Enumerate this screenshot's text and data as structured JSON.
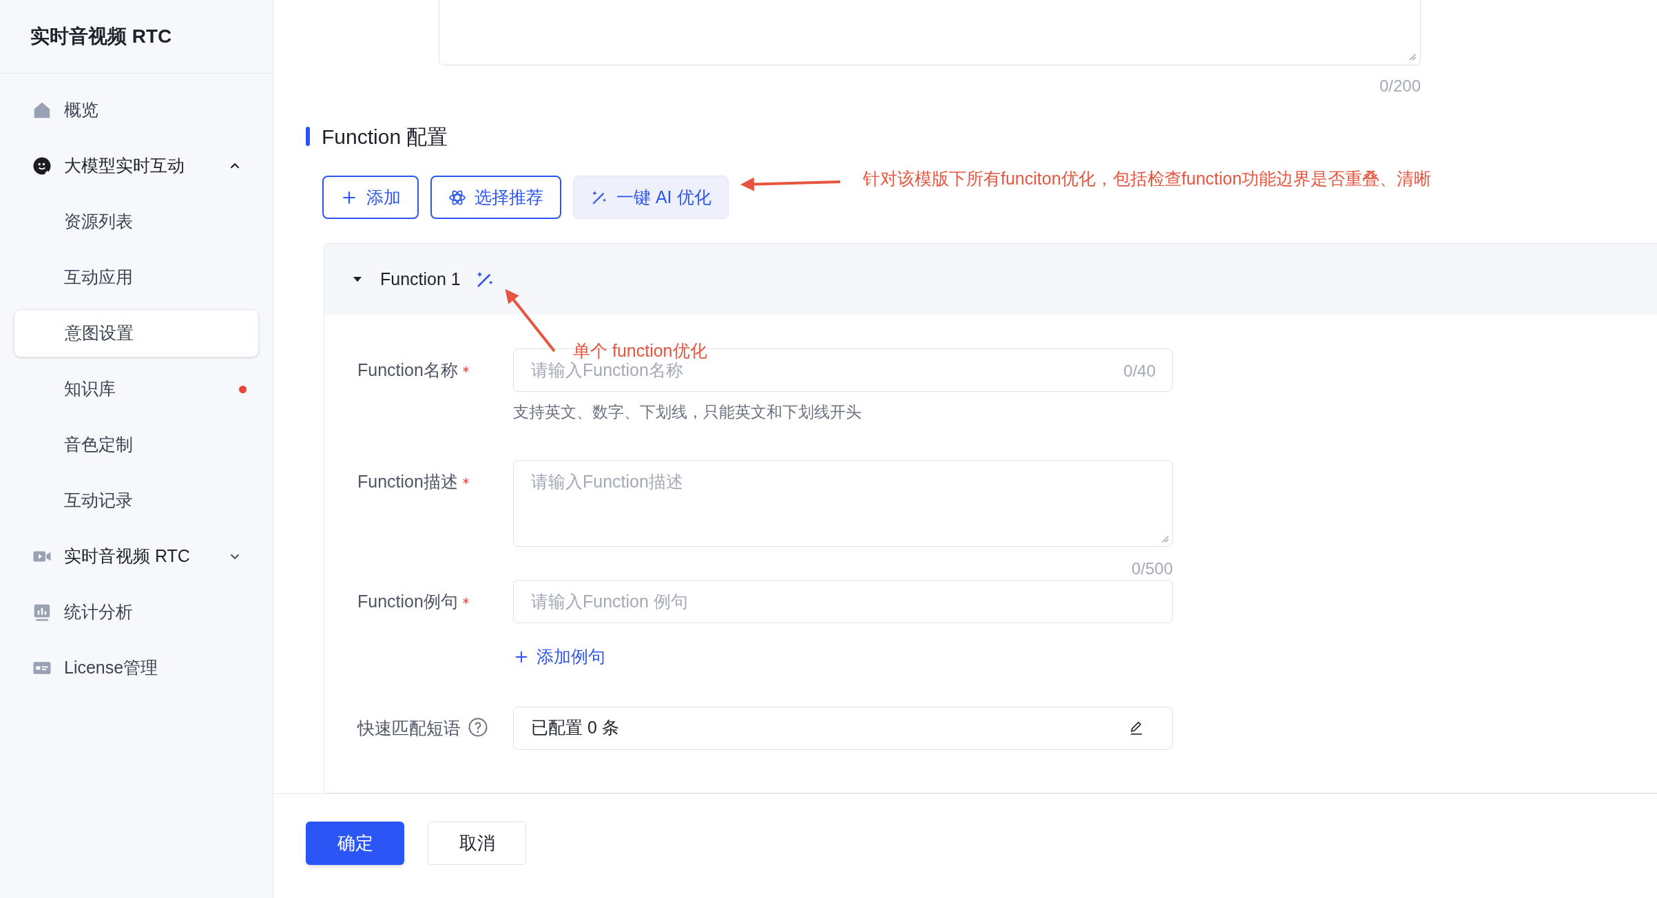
{
  "sidebar": {
    "title": "实时音视频 RTC",
    "items": [
      {
        "kind": "link",
        "label": "概览",
        "selected": false
      },
      {
        "kind": "group",
        "label": "大模型实时互动",
        "expanded": true,
        "children": [
          {
            "label": "资源列表",
            "selected": false
          },
          {
            "label": "互动应用",
            "selected": false
          },
          {
            "label": "意图设置",
            "selected": true
          },
          {
            "label": "知识库",
            "selected": false,
            "color": "#e5483b"
          },
          {
            "label": "音色定制",
            "selected": false
          },
          {
            "label": "互动记录",
            "selected": false
          }
        ]
      },
      {
        "kind": "group",
        "label": "实时音视频 RTC",
        "expanded": false
      },
      {
        "kind": "link",
        "label": "统计分析",
        "selected": false
      },
      {
        "kind": "link",
        "label": "License管理",
        "selected": false
      }
    ]
  },
  "main": {
    "top_counter": "0/200",
    "section_title": "Function 配置",
    "toolbar": [
      {
        "kind": "add",
        "label": "添加"
      },
      {
        "kind": "recommend",
        "label": "选择推荐"
      },
      {
        "kind": "ai",
        "label": "一键 AI 优化"
      }
    ],
    "function_card": {
      "title": "Function 1",
      "expanded": true,
      "fields": [
        {
          "kind": "input",
          "label": "Function名称",
          "required": true,
          "placeholder": "请输入Function名称",
          "counter": "0/40",
          "hint": "支持英文、数字、下划线，只能英文和下划线开头"
        },
        {
          "kind": "textarea",
          "label": "Function描述",
          "required": true,
          "placeholder": "请输入Function描述",
          "counter": "0/500"
        },
        {
          "kind": "input",
          "label": "Function例句",
          "required": true,
          "placeholder": "请输入Function 例句",
          "add_link": "添加例句"
        },
        {
          "kind": "readonly",
          "label": "快速匹配短语",
          "help": true,
          "value": "已配置 0 条"
        }
      ]
    }
  },
  "annotations": [
    {
      "text": "针对该模版下所有funciton优化，包括检查function功能边界是否重叠、清晰"
    },
    {
      "text": "单个 function优化"
    }
  ],
  "footer": {
    "buttons": [
      {
        "kind": "primary",
        "label": "确定"
      },
      {
        "kind": "default",
        "label": "取消"
      }
    ]
  }
}
